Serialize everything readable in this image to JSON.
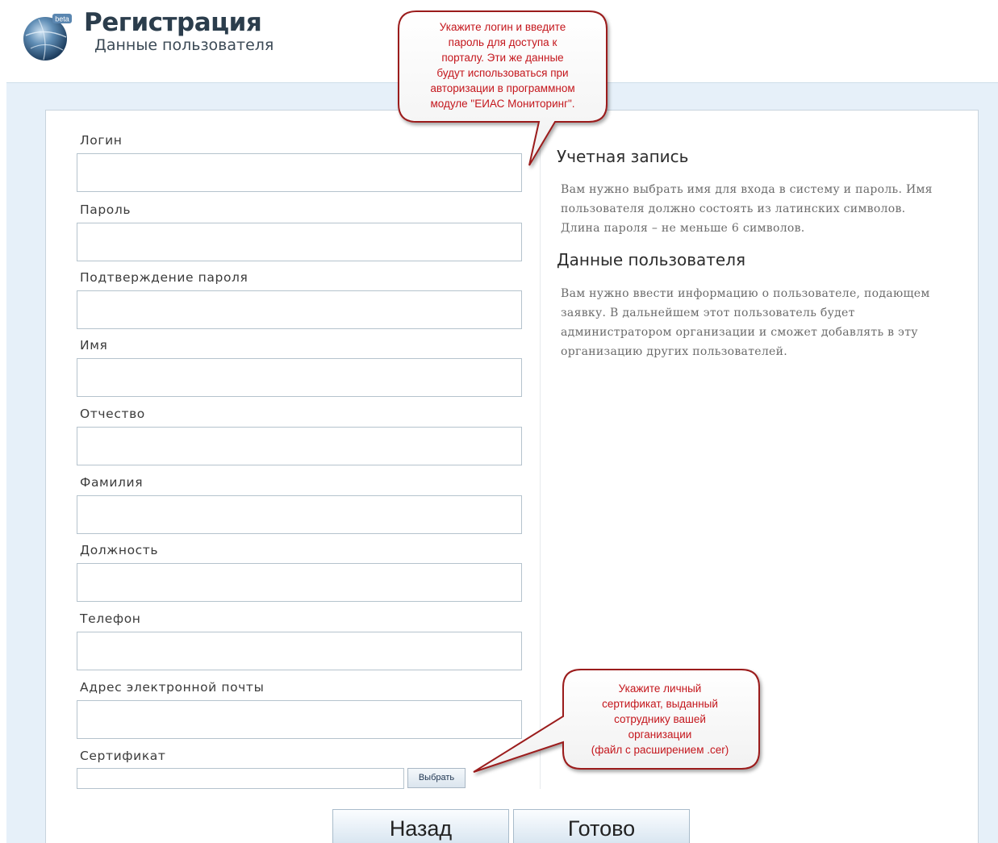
{
  "header": {
    "title": "Регистрация",
    "subtitle": "Данные пользователя",
    "logo_badge": "beta"
  },
  "form": {
    "fields": [
      {
        "label": "Логин",
        "value": ""
      },
      {
        "label": "Пароль",
        "value": ""
      },
      {
        "label": "Подтверждение пароля",
        "value": ""
      },
      {
        "label": "Имя",
        "value": ""
      },
      {
        "label": "Отчество",
        "value": ""
      },
      {
        "label": "Фамилия",
        "value": ""
      },
      {
        "label": "Должность",
        "value": ""
      },
      {
        "label": "Телефон",
        "value": ""
      },
      {
        "label": "Адрес электронной почты",
        "value": ""
      }
    ],
    "certificate": {
      "label": "Сертификат",
      "button_label": "Выбрать"
    }
  },
  "info": {
    "account_title": "Учетная запись",
    "account_text": "Вам нужно выбрать имя для входа в систему и пароль. Имя пользователя должно состоять из латинских символов. Длина пароля – не меньше 6 символов.",
    "user_title": "Данные пользователя",
    "user_text": "Вам нужно ввести информацию о пользователе, подающем заявку. В дальнейшем этот пользователь будет администратором организации и сможет добавлять в эту организацию других пользователей."
  },
  "buttons": {
    "back": "Назад",
    "done": "Готово"
  },
  "callouts": {
    "login_hint": [
      "Укажите логин и введите",
      "пароль для доступа к",
      "порталу. Эти же данные",
      "будут использоваться при",
      "авторизации в программном",
      "модуле \"ЕИАС Мониторинг\"."
    ],
    "cert_hint": [
      "Укажите личный",
      "сертификат, выданный",
      "сотруднику вашей",
      "организации",
      "(файл с расширением .cer)"
    ]
  },
  "colors": {
    "callout_text": "#c4161c",
    "callout_border": "#9b1b1b",
    "frame_bg": "#e6f0f9"
  }
}
